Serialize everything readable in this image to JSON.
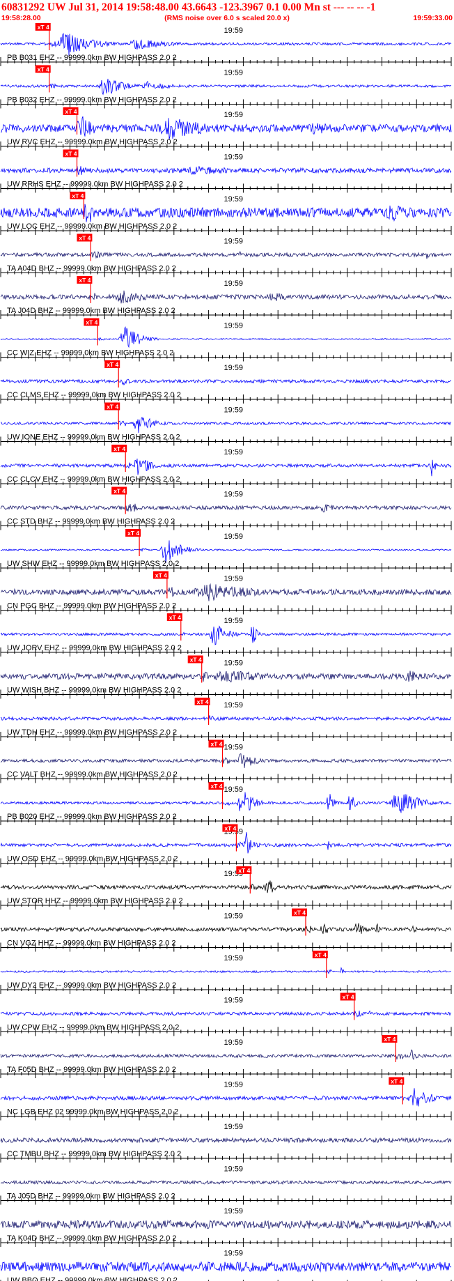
{
  "header": {
    "title": "60831292 UW Jul 31, 2014 19:58:48.00   43.6643 -123.3967   0.1 0.00 Mn st --- -- --   -1",
    "start_time": "19:58:28.00",
    "scale_note": "(RMS noise over 6.0 s scaled 20.0 x)",
    "end_time": "19:59:33.00"
  },
  "colors": {
    "header_text": "#ff0000",
    "pick_box": "#ff0000",
    "pick_line": "#ff0000",
    "trace_blue": "#0000ff",
    "trace_navy": "#1a1a6e",
    "trace_black": "#000000",
    "axis": "#000000"
  },
  "chart_data": {
    "type": "line",
    "title": "60831292 UW Jul 31, 2014 19:58:48.00   43.6643 -123.3967   0.1 0.00 Mn st --- -- --   -1",
    "x_range": [
      "19:58:28.00",
      "19:59:33.00"
    ],
    "x_unit": "seconds",
    "x_ticks": "1 s minor, 5 s major",
    "center_tick_label": "19:59",
    "pick_label": "xT 4",
    "channels": [
      {
        "label": "PB B031 EHZ -- 99999.0km BW  HIGHPASS  2.0  2",
        "color": "blue",
        "pick_s": 7,
        "noise": 0.08,
        "bursts": [
          [
            8,
            10,
            0.9
          ],
          [
            18,
            14,
            0.35
          ]
        ]
      },
      {
        "label": "PB B032 EHZ -- 99999.0km BW  HIGHPASS  2.0  2",
        "color": "blue",
        "pick_s": 7,
        "noise": 0.08,
        "bursts": [
          [
            14,
            8,
            0.7
          ],
          [
            20,
            10,
            0.3
          ]
        ]
      },
      {
        "label": "UW RVC EHZ -- 99999.0km BW  HIGHPASS  2.0  2",
        "color": "blue",
        "pick_s": 11,
        "noise": 0.25,
        "bursts": [
          [
            11,
            6,
            0.8
          ],
          [
            22,
            18,
            0.75
          ],
          [
            44,
            12,
            0.45
          ]
        ]
      },
      {
        "label": "UW RRHS EHZ -- 99999.0km BW  HIGHPASS  2.0  2",
        "color": "blue",
        "pick_s": 11,
        "noise": 0.15,
        "bursts": [
          [
            11,
            4,
            0.45
          ],
          [
            25,
            25,
            0.3
          ]
        ]
      },
      {
        "label": "UW LOC EHZ -- 99999.0km BW  HIGHPASS  2.0  2",
        "color": "blue",
        "pick_s": 12,
        "noise": 0.3,
        "bursts": [
          [
            13,
            5,
            0.5
          ],
          [
            55,
            10,
            0.6
          ]
        ]
      },
      {
        "label": "TA A04D BHZ -- 99999.0km BW  HIGHPASS  2.0  2",
        "color": "navy",
        "pick_s": 13,
        "noise": 0.12,
        "bursts": [
          [
            13,
            4,
            0.35
          ],
          [
            34,
            3,
            0.25
          ],
          [
            61,
            3,
            0.3
          ]
        ]
      },
      {
        "label": "TA J04D BHZ -- 99999.0km BW  HIGHPASS  2.0  2",
        "color": "navy",
        "pick_s": 13,
        "noise": 0.14,
        "bursts": [
          [
            16,
            12,
            0.45
          ],
          [
            38,
            10,
            0.3
          ]
        ]
      },
      {
        "label": "CC WIZ EHZ -- 99999.0km BW  HIGHPASS  2.0  2",
        "color": "blue",
        "pick_s": 14,
        "noise": 0.04,
        "bursts": [
          [
            17,
            6,
            0.95
          ]
        ]
      },
      {
        "label": "CC CLMS EHZ -- 99999.0km BW  HIGHPASS  2.0  2",
        "color": "blue",
        "pick_s": 17,
        "noise": 0.1,
        "bursts": [
          [
            17,
            4,
            0.3
          ]
        ]
      },
      {
        "label": "UW IONE EHZ -- 99999.0km BW  HIGHPASS  2.0  2",
        "color": "blue",
        "pick_s": 17,
        "noise": 0.08,
        "bursts": [
          [
            19,
            6,
            0.7
          ]
        ]
      },
      {
        "label": "CC CLCV EHZ -- 99999.0km BW  HIGHPASS  2.0  2",
        "color": "blue",
        "pick_s": 18,
        "noise": 0.1,
        "bursts": [
          [
            19,
            6,
            0.65
          ],
          [
            62,
            1.5,
            0.75
          ]
        ]
      },
      {
        "label": "CC STD BHZ -- 99999.0km BW  HIGHPASS  2.0  2",
        "color": "navy",
        "pick_s": 18,
        "noise": 0.12,
        "bursts": [
          [
            19,
            3,
            0.35
          ],
          [
            46,
            5,
            0.35
          ]
        ]
      },
      {
        "label": "UW SHW EHZ -- 99999.0km BW  HIGHPASS  2.0  2",
        "color": "blue",
        "pick_s": 20,
        "noise": 0.05,
        "bursts": [
          [
            23,
            6,
            1.0
          ]
        ]
      },
      {
        "label": "CN PGC BHZ -- 99999.0km BW  HIGHPASS  2.0  2",
        "color": "navy",
        "pick_s": 24,
        "noise": 0.18,
        "bursts": [
          [
            27,
            22,
            0.6
          ]
        ]
      },
      {
        "label": "UW JORV EHZ -- 99999.0km BW  HIGHPASS  2.0  2",
        "color": "blue",
        "pick_s": 26,
        "noise": 0.08,
        "bursts": [
          [
            30,
            6,
            0.75
          ],
          [
            36,
            2,
            0.85
          ]
        ]
      },
      {
        "label": "UW WISH BHZ -- 99999.0km BW  HIGHPASS  2.0  2",
        "color": "navy",
        "pick_s": 29,
        "noise": 0.18,
        "bursts": [
          [
            30,
            20,
            0.45
          ],
          [
            58,
            6,
            0.45
          ]
        ]
      },
      {
        "label": "UW TDH EHZ -- 99999.0km BW  HIGHPASS  2.0  2",
        "color": "blue",
        "pick_s": 30,
        "noise": 0.1,
        "bursts": []
      },
      {
        "label": "CC VALT BHZ -- 99999.0km BW  HIGHPASS  2.0  2",
        "color": "navy",
        "pick_s": 32,
        "noise": 0.1,
        "bursts": [
          [
            34,
            6,
            0.6
          ]
        ]
      },
      {
        "label": "PB B020 EHZ -- 99999.0km BW  HIGHPASS  2.0  2",
        "color": "blue",
        "pick_s": 32,
        "noise": 0.08,
        "bursts": [
          [
            34,
            5,
            1.0
          ],
          [
            47,
            2,
            0.9
          ],
          [
            50,
            2,
            0.9
          ],
          [
            56,
            10,
            0.8
          ]
        ]
      },
      {
        "label": "UW OSD EHZ -- 99999.0km BW  HIGHPASS  2.0  2",
        "color": "blue",
        "pick_s": 34,
        "noise": 0.1,
        "bursts": [
          [
            35,
            3,
            0.9
          ],
          [
            47,
            2,
            0.35
          ]
        ]
      },
      {
        "label": "UW STOR HHZ -- 99999.0km BW  HIGHPASS  2.0  2",
        "color": "black",
        "pick_s": 36,
        "noise": 0.12,
        "bursts": [
          [
            38,
            3,
            0.75
          ]
        ]
      },
      {
        "label": "CN VGZ HHZ -- 99999.0km BW  HIGHPASS  2.0  2",
        "color": "black",
        "pick_s": 44,
        "noise": 0.12,
        "bursts": [
          [
            46,
            3,
            0.5
          ],
          [
            51,
            3,
            0.55
          ],
          [
            54,
            2,
            0.45
          ],
          [
            59,
            2,
            0.4
          ]
        ]
      },
      {
        "label": "UW DY2 EHZ -- 99999.0km BW  HIGHPASS  2.0  2",
        "color": "blue",
        "pick_s": 47,
        "noise": 0.06,
        "bursts": [
          [
            49,
            1,
            0.3
          ]
        ]
      },
      {
        "label": "UW CPW EHZ -- 99999.0km BW  HIGHPASS  2.0  2",
        "color": "blue",
        "pick_s": 51,
        "noise": 0.1,
        "bursts": [
          [
            53,
            1,
            0.3
          ]
        ]
      },
      {
        "label": "TA F05D BHZ -- 99999.0km BW  HIGHPASS  2.0  2",
        "color": "navy",
        "pick_s": 57,
        "noise": 0.1,
        "bursts": [
          [
            59,
            2,
            0.5
          ]
        ]
      },
      {
        "label": "NC LGB EHZ 02 99999.0km BW  HIGHPASS  2.0  2",
        "color": "blue",
        "pick_s": 58,
        "noise": 0.12,
        "bursts": [
          [
            59,
            6,
            0.85
          ]
        ]
      },
      {
        "label": "CC TMBU BHZ -- 99999.0km BW  HIGHPASS  2.0  2",
        "color": "navy",
        "pick_s": null,
        "noise": 0.14,
        "bursts": []
      },
      {
        "label": "TA J05D BHZ -- 99999.0km BW  HIGHPASS  2.0  2",
        "color": "navy",
        "pick_s": null,
        "noise": 0.1,
        "bursts": []
      },
      {
        "label": "TA K04D BHZ -- 99999.0km BW  HIGHPASS  2.0  2",
        "color": "navy",
        "pick_s": null,
        "noise": 0.25,
        "bursts": [
          [
            20,
            30,
            0.15
          ]
        ]
      },
      {
        "label": "UW BBO EHZ -- 99999.0km BW  HIGHPASS  2.0  2",
        "color": "blue",
        "pick_s": null,
        "noise": 0.3,
        "bursts": []
      }
    ]
  }
}
